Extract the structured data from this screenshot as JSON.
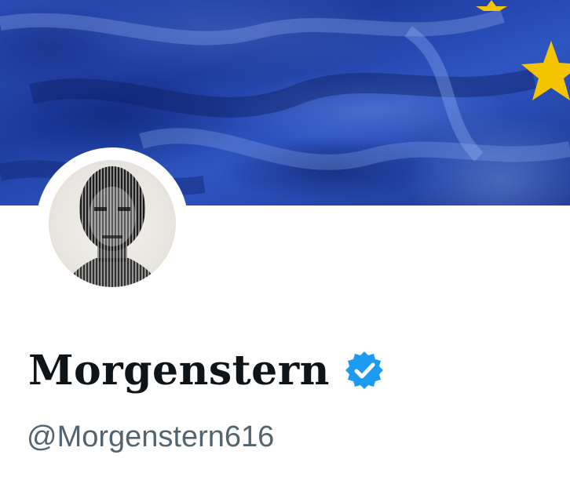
{
  "profile": {
    "display_name": "Morgenstern",
    "handle": "@Morgenstern616",
    "verified": true,
    "verified_icon": "verified-badge-icon",
    "verified_color": "#1d9bf0"
  },
  "banner": {
    "description_color": "#2b4bb4",
    "star_color": "#f5c400"
  },
  "colors": {
    "name": "#0f1419",
    "handle": "#536471",
    "background": "#ffffff"
  }
}
